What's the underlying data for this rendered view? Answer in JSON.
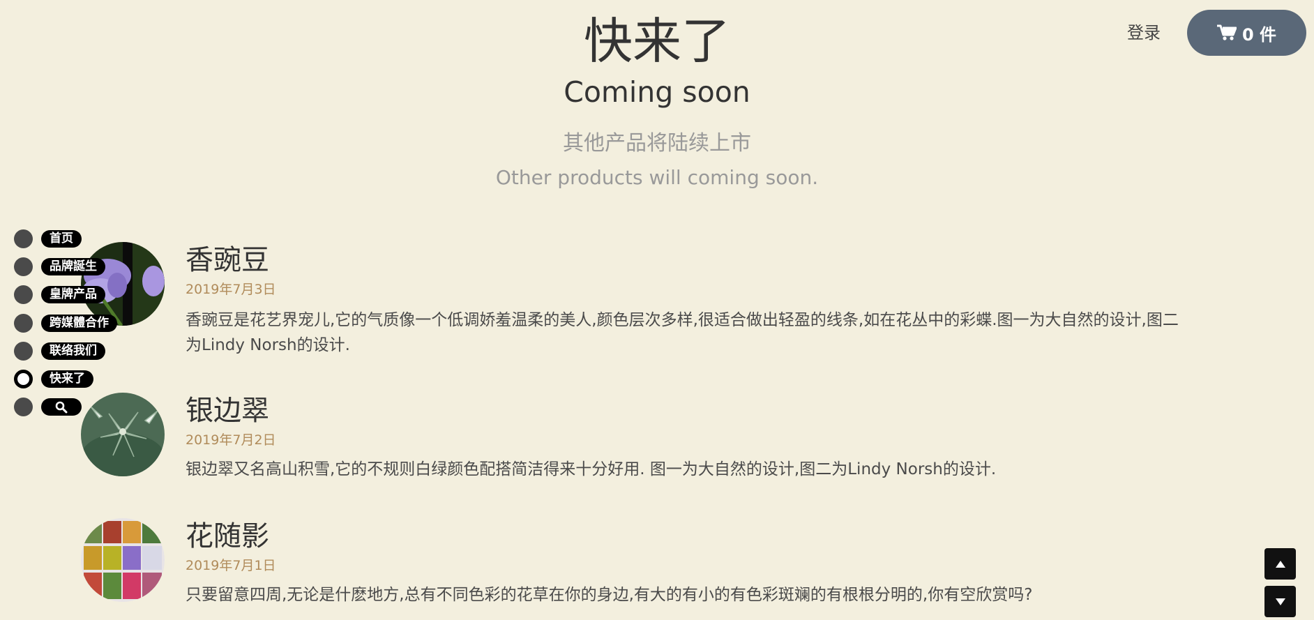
{
  "header": {
    "title": "快来了",
    "subtitle": "Coming soon",
    "intro_cn": "其他产品将陆续上市",
    "intro_en": "Other products will coming soon."
  },
  "topbar": {
    "login_label": "登录",
    "cart_label": "0 件",
    "cart_icon": "shopping-cart-icon",
    "cart_color": "#5a6878"
  },
  "nav": {
    "items": [
      {
        "label": "首页",
        "active": false
      },
      {
        "label": "品牌誕生",
        "active": false
      },
      {
        "label": "皇牌产品",
        "active": false
      },
      {
        "label": "跨媒體合作",
        "active": false
      },
      {
        "label": "联络我们",
        "active": false
      },
      {
        "label": "快来了",
        "active": true
      }
    ],
    "search_icon": "search-icon"
  },
  "posts": [
    {
      "title": "香豌豆",
      "date": "2019年7月3日",
      "body_line1": "香豌豆是花艺界宠儿,它的气质像一个低调娇羞温柔的美人,颜色层次多样,很适合做出轻盈的线条,如在花丛中的彩蝶.图一为大自然的设计,图二",
      "body_line2": "为Lindy Norsh的设计."
    },
    {
      "title": "银边翠",
      "date": "2019年7月2日",
      "body_line1": "银边翠又名高山积雪,它的不规则白绿颜色配搭简洁得来十分好用. 图一为大自然的设计,图二为Lindy Norsh的设计.",
      "body_line2": ""
    },
    {
      "title": "花随影",
      "date": "2019年7月1日",
      "body_line1": "只要留意四周,无论是什麽地方,总有不同色彩的花草在你的身边,有大的有小的有色彩斑斓的有根根分明的,你有空欣赏吗?",
      "body_line2": ""
    }
  ],
  "colors": {
    "background": "#f3efde",
    "date": "#b08b5a",
    "muted": "#999999"
  }
}
